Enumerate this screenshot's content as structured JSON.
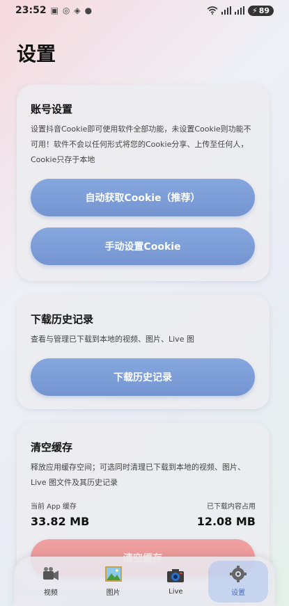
{
  "status_bar": {
    "time": "23:52",
    "notification_icons": [
      "image-icon",
      "target-icon",
      "diamond-icon",
      "dot-icon"
    ],
    "battery": "89"
  },
  "page": {
    "title": "设置"
  },
  "account": {
    "title": "账号设置",
    "description": "设置抖音Cookie即可使用软件全部功能，未设置Cookie则功能不可用！软件不会以任何形式将您的Cookie分享、上传至任何人，Cookie只存于本地",
    "auto_button": "自动获取Cookie（推荐）",
    "manual_button": "手动设置Cookie"
  },
  "history": {
    "title": "下载历史记录",
    "description": "查看与管理已下载到本地的视频、图片、Live 图",
    "button": "下载历史记录"
  },
  "cache": {
    "title": "清空缓存",
    "description": "释放应用缓存空间；可选同时清理已下载到本地的视频、图片、Live 图文件及其历史记录",
    "app_cache_label": "当前 App 缓存",
    "app_cache_value": "33.82 MB",
    "downloaded_label": "已下载内容占用",
    "downloaded_value": "12.08 MB",
    "button": "清空缓存"
  },
  "tabs": [
    {
      "label": "视频",
      "icon": "video-camera-icon"
    },
    {
      "label": "图片",
      "icon": "picture-icon"
    },
    {
      "label": "Live",
      "icon": "camera-icon"
    },
    {
      "label": "设置",
      "icon": "gear-icon"
    }
  ],
  "colors": {
    "button_blue": "#7d9dd8",
    "button_red": "#ec9a9a",
    "active_tab": "#aac3f0"
  }
}
